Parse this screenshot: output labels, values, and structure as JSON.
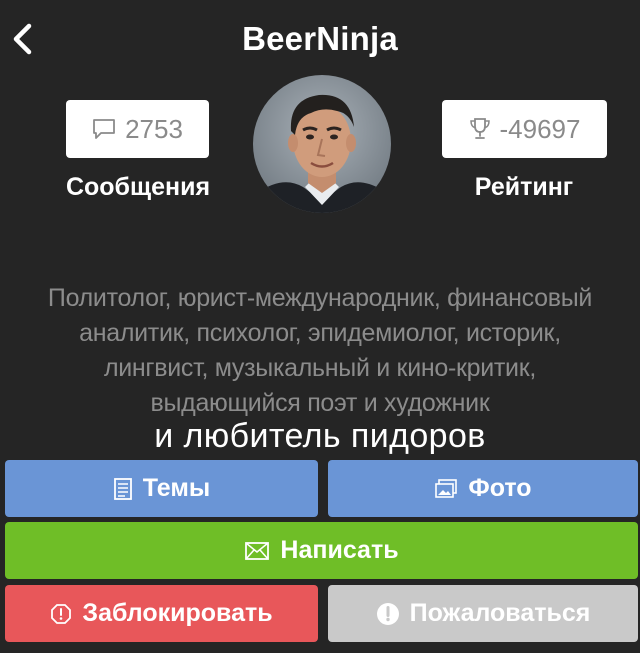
{
  "header": {
    "title": "BeerNinja",
    "back_icon": "chevron-left-icon"
  },
  "stats": {
    "messages": {
      "value": "2753",
      "label": "Сообщения",
      "icon": "speech-bubble-icon"
    },
    "rating": {
      "value": "-49697",
      "label": "Рейтинг",
      "icon": "trophy-icon"
    }
  },
  "profile": {
    "bio_lines": [
      "Политолог, юрист-международник, финансовый",
      "аналитик, психолог, эпидемиолог, историк,",
      "лингвист, музыкальный и кино-критик,",
      "выдающийся поэт и художник"
    ],
    "bio_extra": "и любитель пидоров"
  },
  "actions": {
    "topics": {
      "label": "Темы",
      "icon": "document-icon",
      "color": "#6a95d6"
    },
    "photos": {
      "label": "Фото",
      "icon": "photo-icon",
      "color": "#6a95d6"
    },
    "write": {
      "label": "Написать",
      "icon": "envelope-icon",
      "color": "#6fbe27"
    },
    "block": {
      "label": "Заблокировать",
      "icon": "alert-octagon-icon",
      "color": "#e8575a"
    },
    "report": {
      "label": "Пожаловаться",
      "icon": "exclamation-circle-icon",
      "color": "#c9c9c9"
    }
  },
  "colors": {
    "background": "#252525",
    "stat_text": "#8a8a8a",
    "bio_text": "#8c8c8c"
  }
}
